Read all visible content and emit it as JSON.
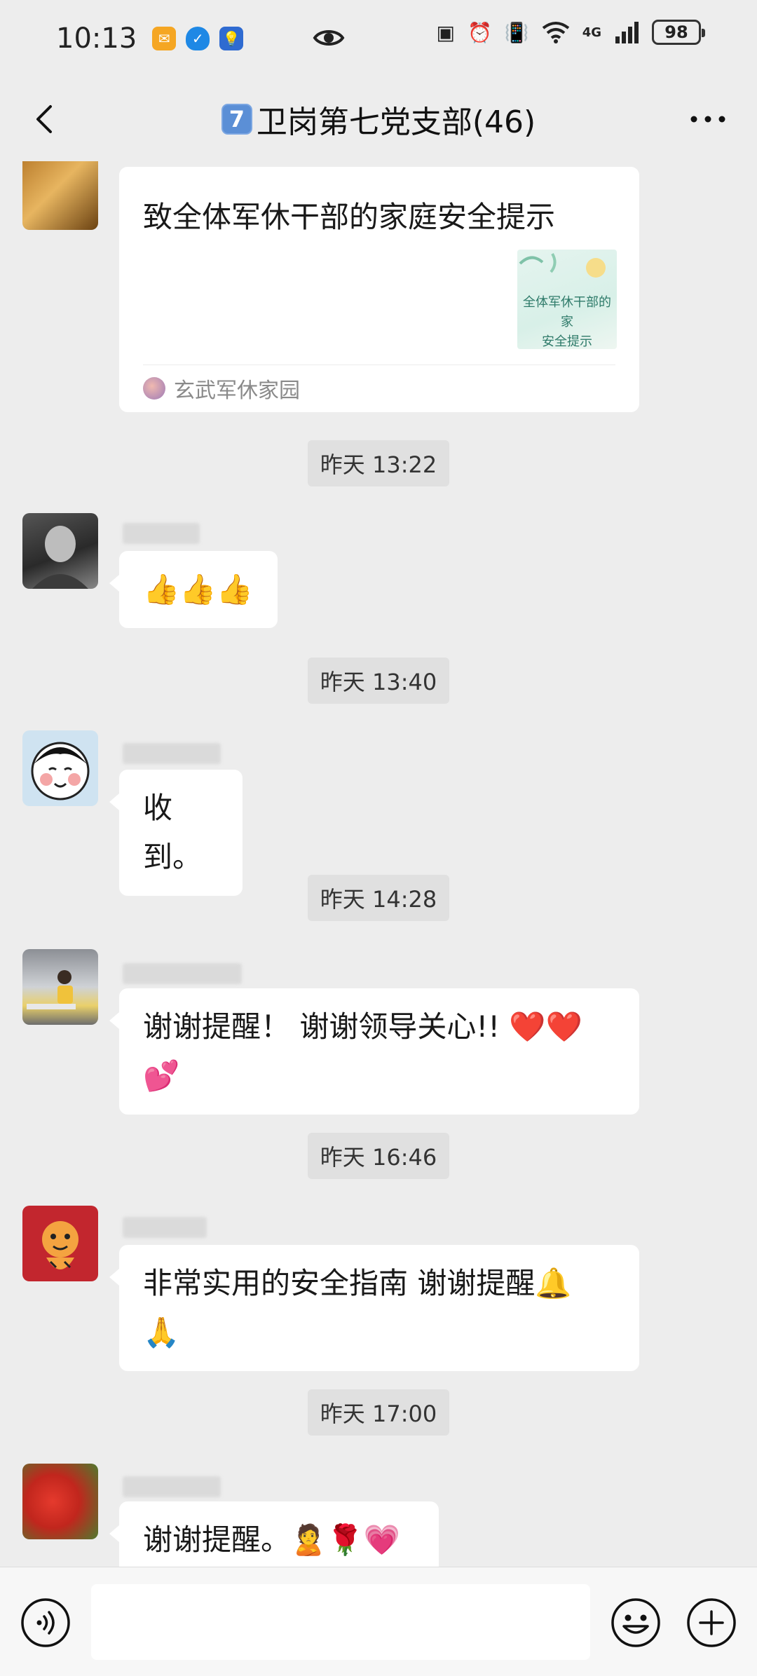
{
  "status_bar": {
    "time": "10:13",
    "battery": "98",
    "network": "4G"
  },
  "header": {
    "badge": "7",
    "title": "卫岗第七党支部(46)"
  },
  "card": {
    "title": "致全体军休干部的家庭安全提示",
    "thumb_text_1": "全体军休干部的家",
    "thumb_text_2": "安全提示",
    "source": "玄武军休家园"
  },
  "messages": [
    {
      "timestamp": "昨天 13:22",
      "text": "👍👍👍"
    },
    {
      "timestamp": "昨天 13:40",
      "text": "收到。"
    },
    {
      "timestamp": "昨天 14:28",
      "text_line1": "谢谢提醒！ 谢谢领导关心!!  ❤️❤️",
      "text_line2": "💕"
    },
    {
      "timestamp": "昨天 16:46",
      "text_line1": "非常实用的安全指南 谢谢提醒🔔",
      "text_line2": "🙏"
    },
    {
      "timestamp": "昨天 17:00",
      "text": "谢谢提醒。🙎🌹💗"
    }
  ],
  "input": {
    "placeholder": ""
  },
  "colors": {
    "background": "#ededed",
    "bubble": "#ffffff",
    "badge": "#5b8fd6"
  },
  "icons": [
    "back-arrow-icon",
    "more-icon",
    "voice-icon",
    "emoji-icon",
    "plus-icon",
    "eye-icon"
  ]
}
